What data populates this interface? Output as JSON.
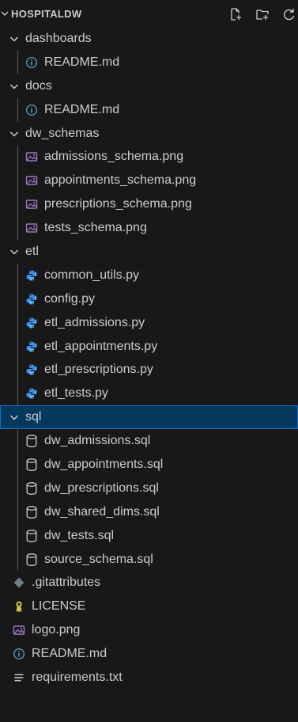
{
  "explorer": {
    "root_label": "HOSPITALDW",
    "items": [
      {
        "type": "folder",
        "label": "dashboards",
        "level": 0
      },
      {
        "type": "file",
        "label": "README.md",
        "level": 1,
        "icon": "info-icon"
      },
      {
        "type": "folder",
        "label": "docs",
        "level": 0
      },
      {
        "type": "file",
        "label": "README.md",
        "level": 1,
        "icon": "info-icon"
      },
      {
        "type": "folder",
        "label": "dw_schemas",
        "level": 0
      },
      {
        "type": "file",
        "label": "admissions_schema.png",
        "level": 1,
        "icon": "image-icon"
      },
      {
        "type": "file",
        "label": "appointments_schema.png",
        "level": 1,
        "icon": "image-icon"
      },
      {
        "type": "file",
        "label": "prescriptions_schema.png",
        "level": 1,
        "icon": "image-icon"
      },
      {
        "type": "file",
        "label": "tests_schema.png",
        "level": 1,
        "icon": "image-icon"
      },
      {
        "type": "folder",
        "label": "etl",
        "level": 0
      },
      {
        "type": "file",
        "label": "common_utils.py",
        "level": 1,
        "icon": "python-icon"
      },
      {
        "type": "file",
        "label": "config.py",
        "level": 1,
        "icon": "python-icon"
      },
      {
        "type": "file",
        "label": "etl_admissions.py",
        "level": 1,
        "icon": "python-icon"
      },
      {
        "type": "file",
        "label": "etl_appointments.py",
        "level": 1,
        "icon": "python-icon"
      },
      {
        "type": "file",
        "label": "etl_prescriptions.py",
        "level": 1,
        "icon": "python-icon"
      },
      {
        "type": "file",
        "label": "etl_tests.py",
        "level": 1,
        "icon": "python-icon"
      },
      {
        "type": "folder",
        "label": "sql",
        "level": 0,
        "selected": true
      },
      {
        "type": "file",
        "label": "dw_admissions.sql",
        "level": 1,
        "icon": "database-icon"
      },
      {
        "type": "file",
        "label": "dw_appointments.sql",
        "level": 1,
        "icon": "database-icon"
      },
      {
        "type": "file",
        "label": "dw_prescriptions.sql",
        "level": 1,
        "icon": "database-icon"
      },
      {
        "type": "file",
        "label": "dw_shared_dims.sql",
        "level": 1,
        "icon": "database-icon"
      },
      {
        "type": "file",
        "label": "dw_tests.sql",
        "level": 1,
        "icon": "database-icon"
      },
      {
        "type": "file",
        "label": "source_schema.sql",
        "level": 1,
        "icon": "database-icon"
      },
      {
        "type": "file",
        "label": ".gitattributes",
        "level": 0,
        "icon": "git-icon"
      },
      {
        "type": "file",
        "label": "LICENSE",
        "level": 0,
        "icon": "license-icon"
      },
      {
        "type": "file",
        "label": "logo.png",
        "level": 0,
        "icon": "image-icon"
      },
      {
        "type": "file",
        "label": "README.md",
        "level": 0,
        "icon": "info-icon"
      },
      {
        "type": "file",
        "label": "requirements.txt",
        "level": 0,
        "icon": "text-lines-icon"
      }
    ]
  },
  "colors": {
    "background": "#181818",
    "text": "#cccccc",
    "selected_bg": "#04395e",
    "selected_border": "#0078d4",
    "info_blue": "#519aba",
    "image_purple": "#a074c4",
    "python_blue": "#3b8eea",
    "license_yellow": "#cbcb41",
    "git_gray": "#6d8086"
  }
}
